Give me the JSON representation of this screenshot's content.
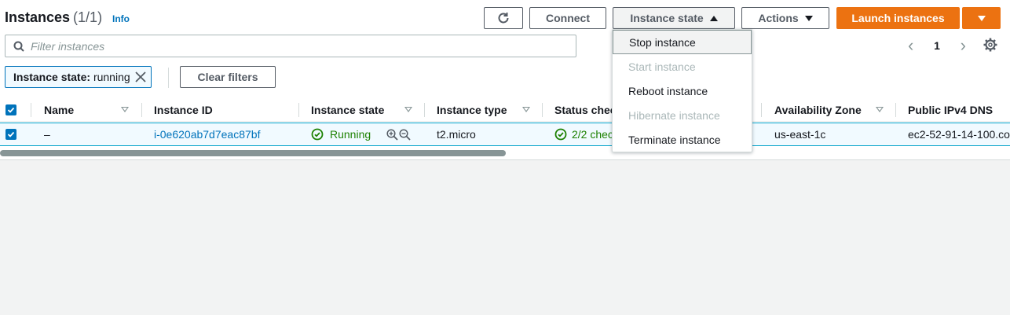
{
  "header": {
    "title": "Instances",
    "count": "(1/1)",
    "info_link": "Info"
  },
  "toolbar": {
    "connect_label": "Connect",
    "instance_state_label": "Instance state",
    "actions_label": "Actions",
    "launch_label": "Launch instances"
  },
  "search": {
    "placeholder": "Filter instances"
  },
  "pagination": {
    "current_page": "1"
  },
  "filter_token": {
    "key": "Instance state:",
    "value": "running"
  },
  "clear_filters_label": "Clear filters",
  "table": {
    "columns": [
      "Name",
      "Instance ID",
      "Instance state",
      "Instance type",
      "Status chec",
      "Availability Zone",
      "Public IPv4 DNS"
    ],
    "rows": [
      {
        "name": "–",
        "instance_id": "i-0e620ab7d7eac87bf",
        "state": "Running",
        "type": "t2.micro",
        "status_check": "2/2 chec",
        "zone": "us-east-1c",
        "dns": "ec2-52-91-14-100.co"
      }
    ]
  },
  "instance_state_menu": {
    "items": [
      {
        "label": "Stop instance",
        "disabled": false
      },
      {
        "label": "Start instance",
        "disabled": true
      },
      {
        "label": "Reboot instance",
        "disabled": false
      },
      {
        "label": "Hibernate instance",
        "disabled": true
      },
      {
        "label": "Terminate instance",
        "disabled": false
      }
    ]
  },
  "colors": {
    "primary": "#ec7211",
    "link": "#0073bb",
    "success": "#1d8102",
    "selected_row": "#f1faff"
  }
}
